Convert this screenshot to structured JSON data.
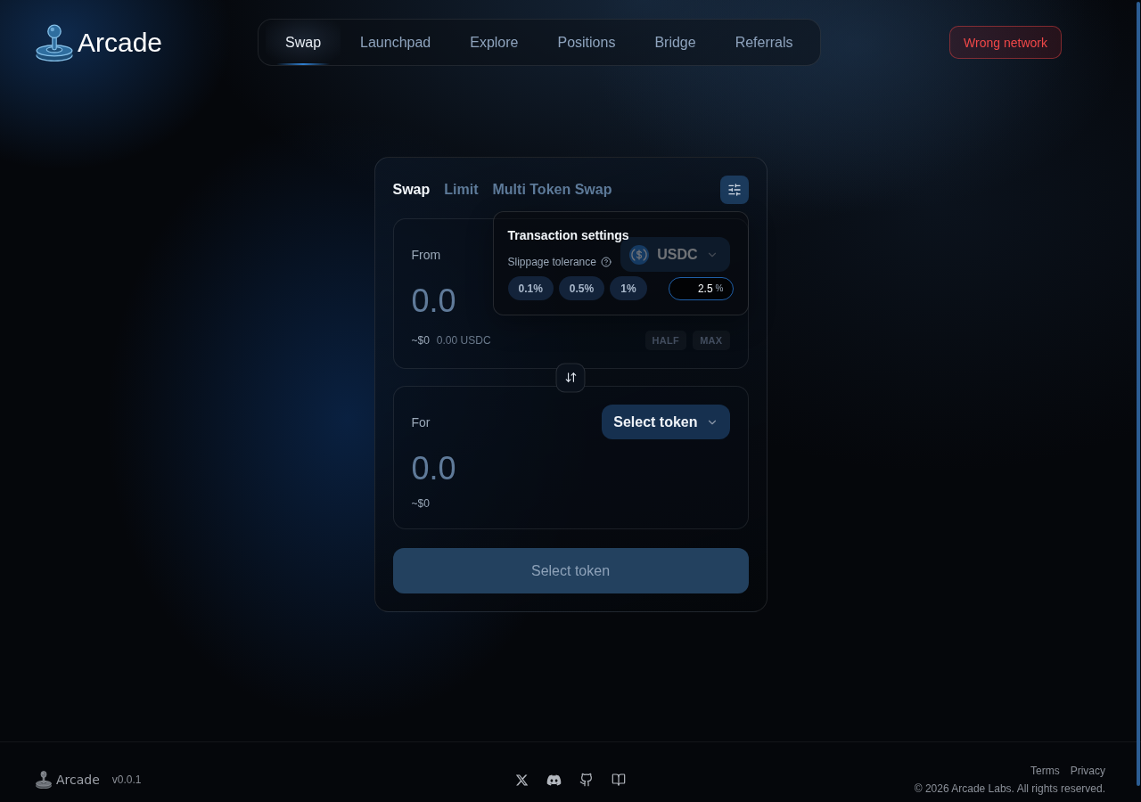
{
  "header": {
    "brand": "Arcade",
    "nav": [
      {
        "label": "Swap",
        "selected": true
      },
      {
        "label": "Launchpad",
        "selected": false
      },
      {
        "label": "Explore",
        "selected": false
      },
      {
        "label": "Positions",
        "selected": false
      },
      {
        "label": "Bridge",
        "selected": false
      },
      {
        "label": "Referrals",
        "selected": false
      }
    ],
    "network_button": "Wrong network"
  },
  "swap_card": {
    "tabs": [
      {
        "label": "Swap",
        "selected": true
      },
      {
        "label": "Limit",
        "selected": false
      },
      {
        "label": "Multi Token Swap",
        "selected": false
      }
    ],
    "from": {
      "label": "From",
      "token": "USDC",
      "placeholder": "0.0",
      "usd_value": "~$0",
      "balance": "0.00 USDC",
      "quick_buttons": [
        "HALF",
        "MAX"
      ]
    },
    "to": {
      "label": "For",
      "token_button": "Select token",
      "placeholder": "0.0",
      "usd_value": "~$0"
    },
    "submit_button": {
      "label": "Select token",
      "disabled": true
    }
  },
  "settings_popover": {
    "open": true,
    "title": "Transaction settings",
    "slippage_label": "Slippage tolerance",
    "presets": [
      {
        "label": "0.1%",
        "selected": false
      },
      {
        "label": "0.5%",
        "selected": false
      },
      {
        "label": "1%",
        "selected": false
      }
    ],
    "custom": {
      "value": "2.5",
      "unit": "%",
      "selected": true
    }
  },
  "footer": {
    "brand": "Arcade",
    "version": "v0.0.1",
    "links": [
      "Terms",
      "Privacy"
    ],
    "copyright": "© 2026 Arcade Labs. All rights reserved."
  }
}
